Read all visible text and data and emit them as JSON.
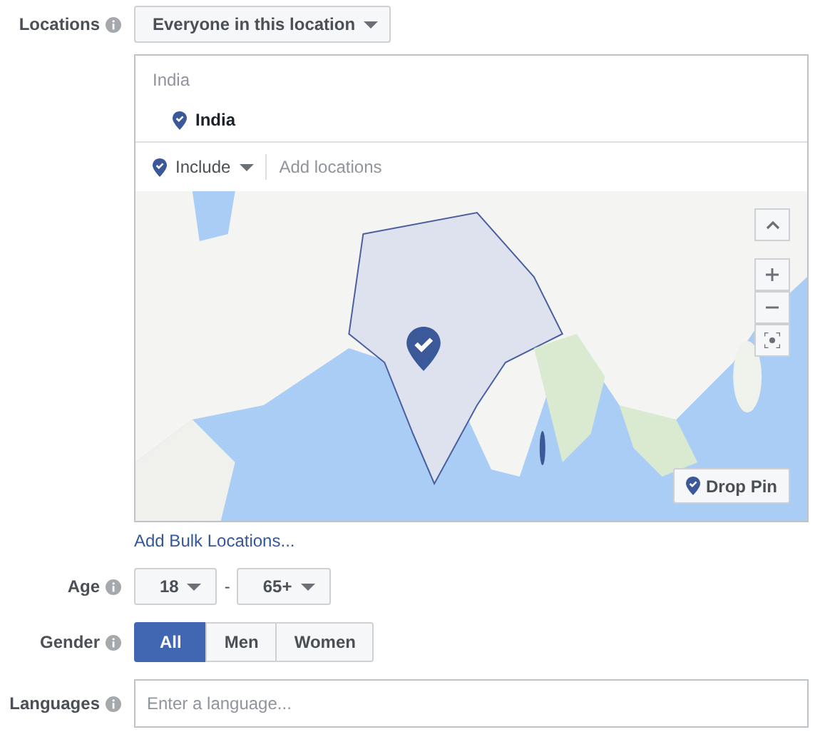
{
  "locations": {
    "label": "Locations",
    "audience": "Everyone in this location",
    "search_header": "India",
    "selected": [
      {
        "name": "India"
      }
    ],
    "mode": "Include",
    "placeholder": "Add locations",
    "drop_pin": "Drop Pin",
    "bulk_link": "Add Bulk Locations..."
  },
  "age": {
    "label": "Age",
    "min": "18",
    "separator": "-",
    "max": "65+"
  },
  "gender": {
    "label": "Gender",
    "options": [
      {
        "label": "All",
        "selected": true
      },
      {
        "label": "Men",
        "selected": false
      },
      {
        "label": "Women",
        "selected": false
      }
    ]
  },
  "languages": {
    "label": "Languages",
    "placeholder": "Enter a language..."
  }
}
